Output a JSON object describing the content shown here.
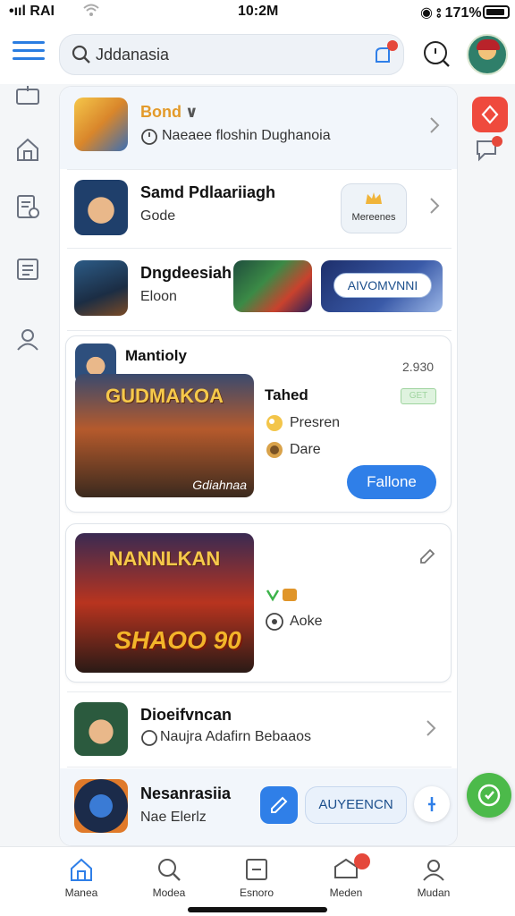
{
  "status_bar": {
    "signal": "•ııl RAI",
    "time": "10:2M",
    "battery": "◉ ⦂ 171%"
  },
  "search": {
    "value": "Jddanasia"
  },
  "items": [
    {
      "title": "Bond",
      "title_suffix": "∨",
      "subtitle": "Naeaee floshin Dughanoia"
    },
    {
      "title": "Samd Pdlaariiagh",
      "subtitle": "Gode",
      "button": "Mereenes"
    },
    {
      "title": "Dngdeesiah",
      "subtitle": "Eloon",
      "banner_button": "AIVOMVNNI"
    }
  ],
  "card1": {
    "header": "Mantioly",
    "count": "2.930",
    "art_title": "GUDMAKOA",
    "art_caption": "Gdiahnaa",
    "status": "Tahed",
    "tag": "GET",
    "row1": "Presren",
    "row2": "Dare",
    "button": "Fallone"
  },
  "card2": {
    "art_title": "NANNLKAN",
    "art_number": "SHAOO 90",
    "row": "Aoke"
  },
  "item4": {
    "title": "Dioeifvncan",
    "subtitle": "Naujra Adafirn Bebaaos"
  },
  "item5": {
    "title": "Nesanrasiia",
    "subtitle": "Nae Elerlz",
    "button": "AUYEENCN"
  },
  "nav": [
    {
      "label": "Manea"
    },
    {
      "label": "Modea"
    },
    {
      "label": "Esnoro"
    },
    {
      "label": "Meden"
    },
    {
      "label": "Mudan"
    }
  ],
  "colors": {
    "accent": "#2f7fe8",
    "red": "#ef4a3d",
    "green": "#4cba4a"
  }
}
